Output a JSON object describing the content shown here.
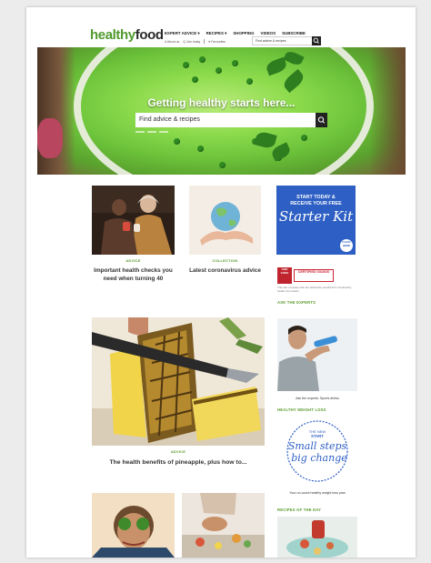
{
  "header": {
    "logo_part1": "healthy",
    "logo_part2": "food",
    "nav": [
      "EXPERT ADVICE ▾",
      "RECIPES ▾",
      "SHOPPING",
      "VIDEOS",
      "SUBSCRIBE"
    ],
    "subnav": [
      "A About us",
      "Q Join today",
      "♥ Favourites"
    ],
    "search_placeholder": "Find advice & recipes",
    "search_icon": "search-icon"
  },
  "hero": {
    "title": "Getting healthy starts here...",
    "search_placeholder": "Find advice & recipes"
  },
  "cards": [
    {
      "tag": "ADVICE",
      "title": "Important health checks you need when turning 40"
    },
    {
      "tag": "COLLECTION",
      "title": "Latest coronavirus advice"
    },
    {
      "tag": "ADVICE",
      "title": "The health benefits of pineapple, plus how to..."
    }
  ],
  "sidebar": {
    "promo_line1": "START TODAY &",
    "promo_line2": "RECEIVE YOUR FREE",
    "promo_big": "Starter Kit",
    "promo_badge": "CLICK HERE",
    "cert_logo": "HON CODE",
    "cert_label": "CERTIFIED 03/2020",
    "cert_text": "This site complies with the HONcode standard for trustworthy health information",
    "ask_label": "ASK THE EXPERTS",
    "ask_caption": "Ask the experts: Sports drinks",
    "weight_label": "HEALTHY WEIGHT LOSS",
    "weight_small1": "THE NEW",
    "weight_small2": "START",
    "weight_big1": "Small steps",
    "weight_big2": "big change",
    "weight_caption": "Your no-count healthy weight loss plan",
    "recipes_label": "RECIPES OF THE DAY"
  },
  "colors": {
    "brand_green": "#5a9a2d",
    "promo_blue": "#2e5fc4",
    "cert_red": "#c0242f"
  }
}
